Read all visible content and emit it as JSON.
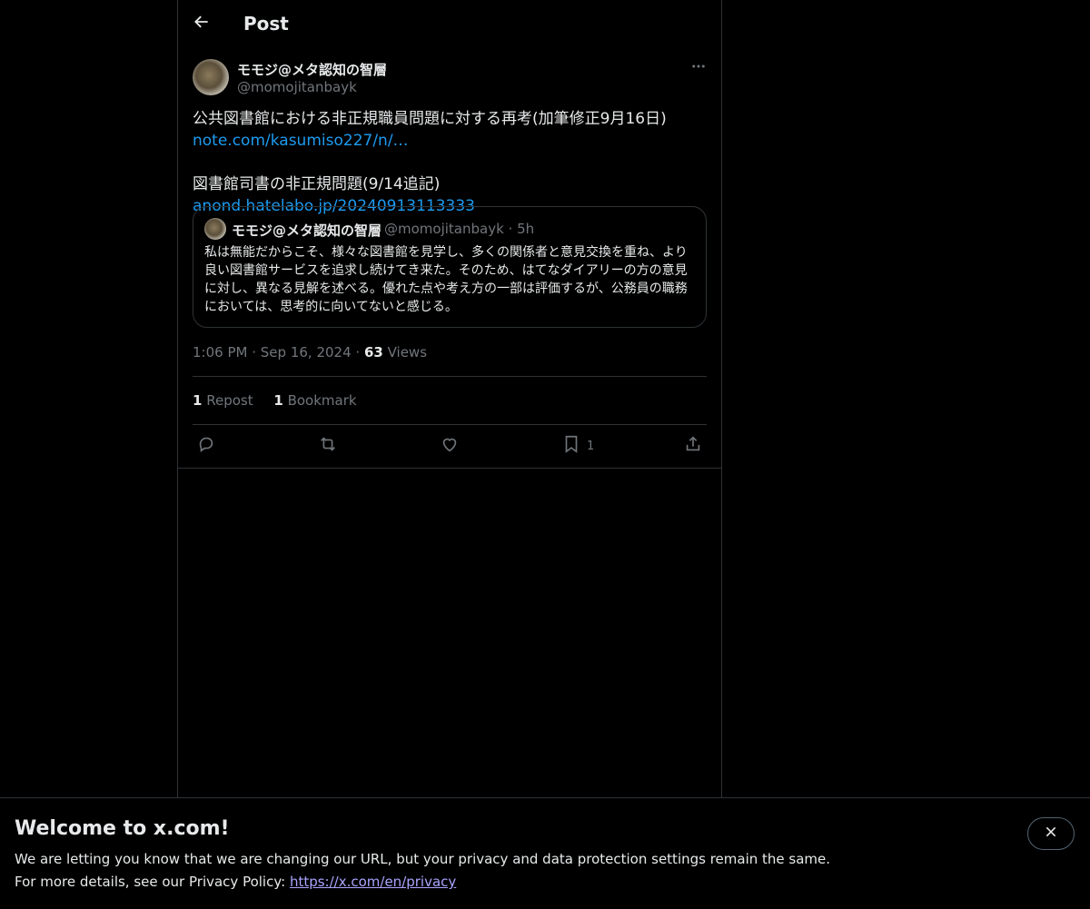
{
  "header": {
    "title": "Post"
  },
  "post": {
    "author_name": "モモジ@メタ認知の智層",
    "author_handle": "@momojitanbayk",
    "text_line1": "公共図書館における非正規職員問題に対する再考(加筆修正9月16日)",
    "link1": "note.com/kasumiso227/n/…",
    "text_line2": "図書館司書の非正規問題(9/14追記) ",
    "link2": "anond.hatelabo.jp/20240913113333",
    "time": "1:06 PM",
    "date": "Sep 16, 2024",
    "views_count": "63",
    "views_label": "Views",
    "reposts_count": "1",
    "reposts_label": "Repost",
    "bookmarks_count": "1",
    "bookmarks_label": "Bookmark",
    "bookmark_action_count": "1"
  },
  "quote": {
    "author_name": "モモジ@メタ認知の智層",
    "meta": "@momojitanbayk · 5h",
    "text": "私は無能だからこそ、様々な図書館を見学し、多くの関係者と意見交換を重ね、より良い図書館サービスを追求し続けてき来た。そのため、はてなダイアリーの方の意見に対し、異なる見解を述べる。優れた点や考え方の一部は評価するが、公務員の職務においては、思考的に向いてないと感じる。"
  },
  "banner": {
    "title": "Welcome to x.com!",
    "line1": "We are letting you know that we are changing our URL, but your privacy and data protection settings remain the same.",
    "line2_prefix": "For more details, see our Privacy Policy: ",
    "line2_link": "https://x.com/en/privacy"
  },
  "icons": {
    "back": "arrow-left-icon",
    "more": "more-horizontal-icon",
    "reply": "reply-icon",
    "repost": "repost-icon",
    "like": "heart-icon",
    "bookmark": "bookmark-icon",
    "share": "share-icon",
    "close": "close-icon"
  },
  "colors": {
    "link": "#1d9bf0",
    "muted": "#71767b",
    "border": "#2f3336",
    "privacy_link": "#a9a4ff"
  }
}
